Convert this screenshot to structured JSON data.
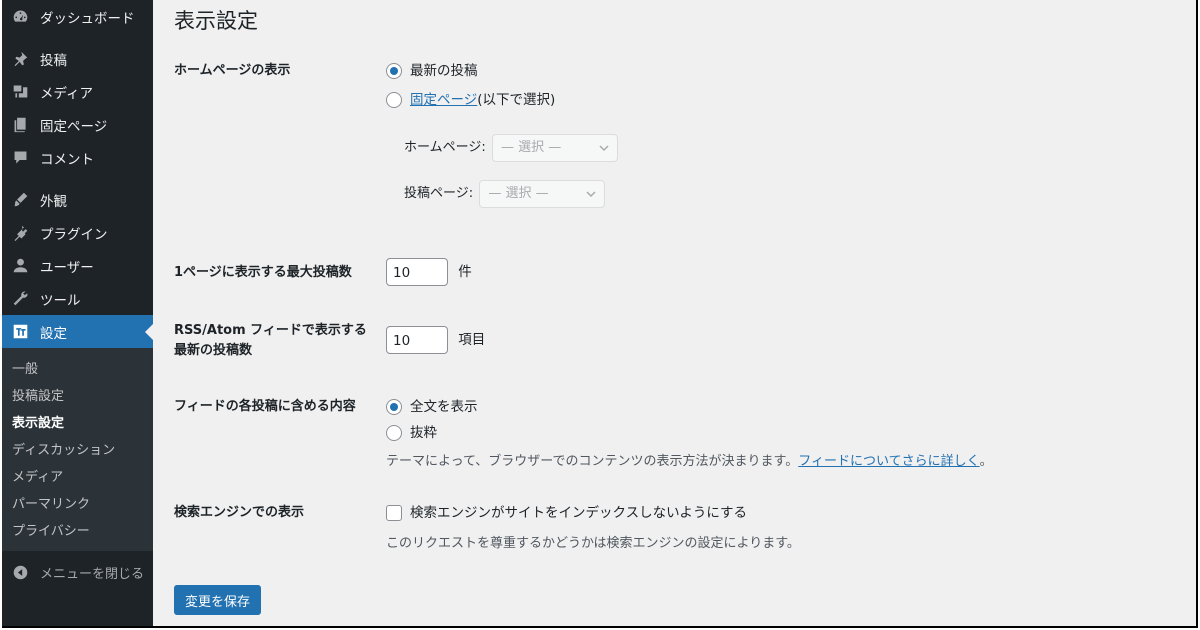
{
  "sidebar": {
    "items": [
      {
        "label": "ダッシュボード",
        "icon": "dashboard-icon"
      },
      {
        "label": "投稿",
        "icon": "pin-icon"
      },
      {
        "label": "メディア",
        "icon": "media-icon"
      },
      {
        "label": "固定ページ",
        "icon": "pages-icon"
      },
      {
        "label": "コメント",
        "icon": "comment-icon"
      },
      {
        "label": "外観",
        "icon": "appearance-icon"
      },
      {
        "label": "プラグイン",
        "icon": "plugin-icon"
      },
      {
        "label": "ユーザー",
        "icon": "user-icon"
      },
      {
        "label": "ツール",
        "icon": "tools-icon"
      },
      {
        "label": "設定",
        "icon": "settings-icon"
      }
    ],
    "submenu": [
      "一般",
      "投稿設定",
      "表示設定",
      "ディスカッション",
      "メディア",
      "パーマリンク",
      "プライバシー"
    ],
    "collapse_label": "メニューを閉じる"
  },
  "page": {
    "title": "表示設定",
    "homepage": {
      "label": "ホームページの表示",
      "opt_latest": "最新の投稿",
      "opt_static_link": "固定ページ",
      "opt_static_suffix": " (以下で選択)",
      "home_label": "ホームページ:",
      "posts_label": "投稿ページ:",
      "select_placeholder": "— 選択 —"
    },
    "per_page": {
      "label": "1ページに表示する最大投稿数",
      "value": "10",
      "unit": "件"
    },
    "rss": {
      "label_line1": "RSS/Atom フィードで表示する",
      "label_line2": "最新の投稿数",
      "value": "10",
      "unit": "項目"
    },
    "feed": {
      "label": "フィードの各投稿に含める内容",
      "opt_full": "全文を表示",
      "opt_excerpt": "抜粋",
      "desc_prefix": "テーマによって、ブラウザーでのコンテンツの表示方法が決まります。",
      "desc_link": "フィードについてさらに詳しく",
      "desc_suffix": "。"
    },
    "search": {
      "label": "検索エンジンでの表示",
      "checkbox_label": "検索エンジンがサイトをインデックスしないようにする",
      "desc": "このリクエストを尊重するかどうかは検索エンジンの設定によります。"
    },
    "save_label": "変更を保存"
  },
  "colors": {
    "sidebar_bg": "#1d2327",
    "accent": "#2271b1",
    "content_bg": "#f0f0f1"
  }
}
